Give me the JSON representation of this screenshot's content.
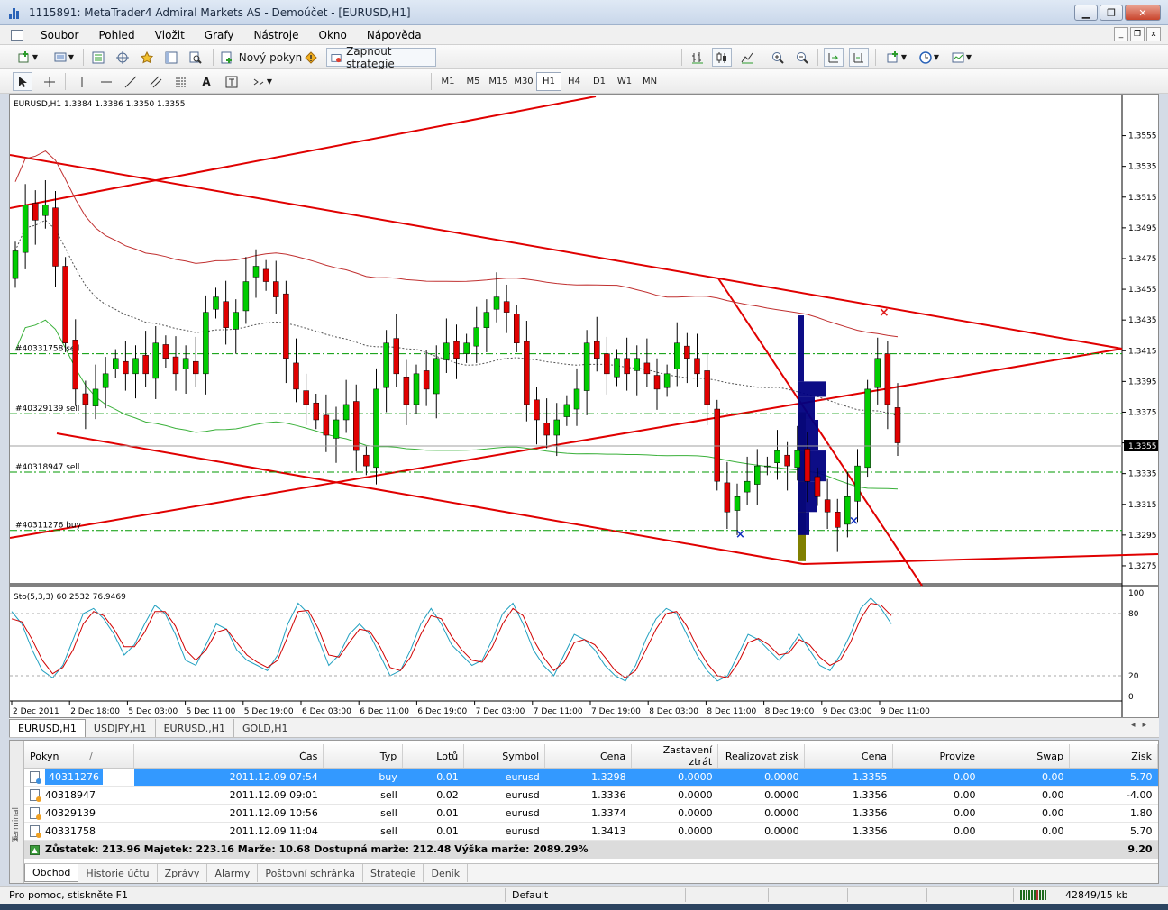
{
  "window": {
    "title": "1115891: MetaTrader4 Admiral Markets AS - Demoúčet - [EURUSD,H1]",
    "btn_minimize": "▁",
    "btn_restore": "❐",
    "btn_close": "✕"
  },
  "menu": [
    "Soubor",
    "Pohled",
    "Vložit",
    "Grafy",
    "Nástroje",
    "Okno",
    "Nápověda"
  ],
  "mdi": [
    "_",
    "❐",
    "x"
  ],
  "toolbar": {
    "new_order_label": "Nový pokyn",
    "strategy_label": "Zapnout strategie",
    "timeframes": [
      "M1",
      "M5",
      "M15",
      "M30",
      "H1",
      "H4",
      "D1",
      "W1",
      "MN"
    ],
    "active_timeframe": "H1",
    "text_tool": "A"
  },
  "chart": {
    "header": "EURUSD,H1  1.3384 1.3386 1.3350 1.3355",
    "current_price": "1.3355",
    "stoch_header": "Sto(5,3,3) 60.2532 76.9469",
    "colors": {
      "bull": "#00cc00",
      "bear": "#e00000",
      "trendline": "#e00000",
      "ma_red": "#c03030",
      "ma_green": "#3ab03a",
      "order_line": "#009900",
      "volume_profile": "#000080",
      "volume_bar": "#808000",
      "stoch_main": "#20a0c0",
      "stoch_signal": "#d00000"
    }
  },
  "chart_data": {
    "type": "candlestick",
    "symbol": "EURUSD",
    "timeframe": "H1",
    "ylim": [
      1.3265,
      1.357
    ],
    "y_ticks": [
      "1.3555",
      "1.3535",
      "1.3515",
      "1.3495",
      "1.3475",
      "1.3455",
      "1.3435",
      "1.3415",
      "1.3395",
      "1.3375",
      "1.3355",
      "1.3335",
      "1.3315",
      "1.3295",
      "1.3275"
    ],
    "x_ticks": [
      "2 Dec 2011",
      "2 Dec 18:00",
      "5 Dec 03:00",
      "5 Dec 11:00",
      "5 Dec 19:00",
      "6 Dec 03:00",
      "6 Dec 11:00",
      "6 Dec 19:00",
      "7 Dec 03:00",
      "7 Dec 11:00",
      "7 Dec 19:00",
      "8 Dec 03:00",
      "8 Dec 11:00",
      "8 Dec 19:00",
      "9 Dec 03:00",
      "9 Dec 11:00"
    ],
    "order_lines": [
      {
        "label": "#40331758 sell",
        "price": 1.3413
      },
      {
        "label": "#40329139 sell",
        "price": 1.3374
      },
      {
        "label": "#40318947 sell",
        "price": 1.3336
      },
      {
        "label": "#40311276 buy",
        "price": 1.3298
      }
    ],
    "close": [
      1.348,
      1.351,
      1.35,
      1.351,
      1.347,
      1.342,
      1.339,
      1.338,
      1.339,
      1.34,
      1.341,
      1.34,
      1.341,
      1.34,
      1.342,
      1.341,
      1.34,
      1.341,
      1.34,
      1.344,
      1.345,
      1.343,
      1.344,
      1.346,
      1.347,
      1.346,
      1.345,
      1.341,
      1.339,
      1.338,
      1.337,
      1.336,
      1.337,
      1.338,
      1.335,
      1.334,
      1.339,
      1.342,
      1.34,
      1.338,
      1.34,
      1.339,
      1.341,
      1.342,
      1.341,
      1.342,
      1.343,
      1.344,
      1.345,
      1.344,
      1.342,
      1.338,
      1.337,
      1.336,
      1.337,
      1.338,
      1.339,
      1.342,
      1.341,
      1.34,
      1.341,
      1.34,
      1.341,
      1.34,
      1.339,
      1.34,
      1.342,
      1.341,
      1.34,
      1.338,
      1.333,
      1.331,
      1.332,
      1.333,
      1.334,
      1.334,
      1.335,
      1.334,
      1.335,
      1.333,
      1.332,
      1.331,
      1.33,
      1.332,
      1.334,
      1.339,
      1.341,
      1.338,
      1.3355
    ],
    "stochastic": {
      "main": [
        82,
        70,
        45,
        25,
        18,
        30,
        55,
        80,
        85,
        75,
        60,
        40,
        50,
        70,
        88,
        80,
        60,
        35,
        30,
        50,
        70,
        65,
        45,
        35,
        30,
        25,
        40,
        70,
        90,
        80,
        55,
        30,
        40,
        60,
        70,
        60,
        40,
        20,
        25,
        45,
        70,
        85,
        70,
        50,
        40,
        30,
        35,
        55,
        80,
        90,
        70,
        45,
        30,
        20,
        40,
        60,
        55,
        45,
        30,
        20,
        15,
        30,
        55,
        75,
        85,
        80,
        60,
        40,
        25,
        15,
        20,
        40,
        60,
        55,
        45,
        35,
        45,
        60,
        45,
        30,
        25,
        40,
        60,
        85,
        95,
        85,
        70
      ],
      "signal": [
        75,
        72,
        55,
        35,
        22,
        28,
        45,
        70,
        82,
        78,
        65,
        48,
        48,
        62,
        82,
        82,
        68,
        45,
        35,
        45,
        62,
        65,
        52,
        40,
        33,
        28,
        35,
        58,
        82,
        83,
        65,
        40,
        38,
        52,
        65,
        63,
        48,
        28,
        25,
        38,
        60,
        78,
        75,
        58,
        45,
        35,
        33,
        48,
        70,
        85,
        78,
        55,
        38,
        25,
        33,
        52,
        55,
        50,
        38,
        25,
        18,
        25,
        45,
        65,
        80,
        82,
        68,
        48,
        32,
        20,
        18,
        32,
        52,
        56,
        50,
        40,
        42,
        55,
        50,
        38,
        30,
        35,
        52,
        75,
        90,
        88,
        78
      ],
      "levels": [
        "100",
        "80",
        "20",
        "0"
      ]
    }
  },
  "chart_tabs": [
    "EURUSD,H1",
    "USDJPY,H1",
    "EURUSD.,H1",
    "GOLD,H1"
  ],
  "orders_table": {
    "columns": [
      "Pokyn",
      "Čas",
      "Typ",
      "Lotů",
      "Symbol",
      "Cena",
      "Zastavení ztrát",
      "Realizovat zisk",
      "Cena",
      "Provize",
      "Swap",
      "Zisk"
    ],
    "sort_marker": "/",
    "rows": [
      [
        "40311276",
        "2011.12.09 07:54",
        "buy",
        "0.01",
        "eurusd",
        "1.3298",
        "0.0000",
        "0.0000",
        "1.3355",
        "0.00",
        "0.00",
        "5.70"
      ],
      [
        "40318947",
        "2011.12.09 09:01",
        "sell",
        "0.02",
        "eurusd",
        "1.3336",
        "0.0000",
        "0.0000",
        "1.3356",
        "0.00",
        "0.00",
        "-4.00"
      ],
      [
        "40329139",
        "2011.12.09 10:56",
        "sell",
        "0.01",
        "eurusd",
        "1.3374",
        "0.0000",
        "0.0000",
        "1.3356",
        "0.00",
        "0.00",
        "1.80"
      ],
      [
        "40331758",
        "2011.12.09 11:04",
        "sell",
        "0.01",
        "eurusd",
        "1.3413",
        "0.0000",
        "0.0000",
        "1.3356",
        "0.00",
        "0.00",
        "5.70"
      ]
    ],
    "summary": "Zůstatek: 213.96  Majetek: 223.16  Marže: 10.68  Dostupná marže: 212.48  Výška marže: 2089.29%",
    "summary_total": "9.20"
  },
  "terminal": {
    "side_label": "Terminal",
    "close": "x",
    "tabs": [
      "Obchod",
      "Historie účtu",
      "Zprávy",
      "Alarmy",
      "Poštovní schránka",
      "Strategie",
      "Deník"
    ]
  },
  "status": {
    "help": "Pro pomoc, stiskněte F1",
    "profile": "Default",
    "traffic": "42849/15 kb"
  }
}
